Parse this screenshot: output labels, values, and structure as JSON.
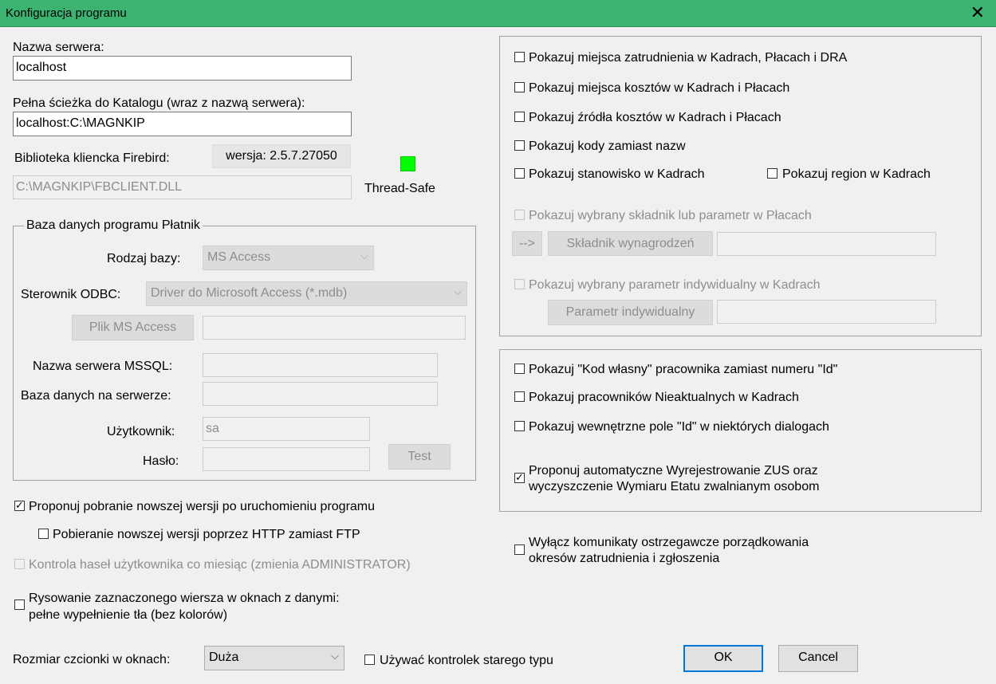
{
  "window": {
    "title": "Konfiguracja programu",
    "close_glyph": "✕"
  },
  "server": {
    "name_label": "Nazwa serwera:",
    "name_value": "localhost",
    "path_label": "Pełna ścieżka do Katalogu (wraz z nazwą serwera):",
    "path_value": "localhost:C:\\MAGNKIP",
    "client_label": "Biblioteka kliencka Firebird:",
    "client_version": "wersja: 2.5.7.27050",
    "client_path": "C:\\MAGNKIP\\FBCLIENT.DLL",
    "thread_safe_label": "Thread-Safe",
    "thread_safe_color": "#00ff00"
  },
  "db_group": {
    "legend": "Baza danych programu Płatnik",
    "type_label": "Rodzaj bazy:",
    "type_value": "MS Access",
    "odbc_label": "Sterownik ODBC:",
    "odbc_value": "Driver do Microsoft Access (*.mdb)",
    "ms_access_button": "Plik MS Access",
    "ms_access_value": "",
    "mssql_label": "Nazwa serwera MSSQL:",
    "mssql_value": "",
    "dbname_label": "Baza danych na serwerze:",
    "dbname_value": "",
    "user_label": "Użytkownik:",
    "user_value": "sa",
    "pass_label": "Hasło:",
    "pass_value": "",
    "test_button": "Test"
  },
  "left_options": [
    {
      "label": "Proponuj pobranie nowszej wersji po uruchomieniu programu",
      "checked": true,
      "enabled": true
    },
    {
      "label": "Pobieranie nowszej wersji poprzez HTTP zamiast FTP",
      "checked": false,
      "enabled": true
    },
    {
      "label": "Kontrola haseł użytkownika co miesiąc (zmienia ADMINISTRATOR)",
      "checked": false,
      "enabled": false
    },
    {
      "label_line1": "Rysowanie zaznaczonego wiersza w oknach z danymi:",
      "label_line2": "pełne wypełnienie tła (bez kolorów)",
      "checked": false,
      "enabled": true
    }
  ],
  "font_size": {
    "label": "Rozmiar czcionki w oknach:",
    "value": "Duża"
  },
  "old_controls": {
    "label": "Używać kontrolek starego typu",
    "checked": false
  },
  "right_group1": {
    "options": [
      {
        "label": "Pokazuj miejsca zatrudnienia w Kadrach, Płacach i DRA",
        "checked": false
      },
      {
        "label": "Pokazuj miejsca kosztów w Kadrach i Płacach",
        "checked": false
      },
      {
        "label": "Pokazuj źródła kosztów w Kadrach i Płacach",
        "checked": false
      },
      {
        "label": "Pokazuj kody zamiast nazw",
        "checked": false
      },
      {
        "label": "Pokazuj stanowisko w Kadrach",
        "checked": false
      },
      {
        "label": "Pokazuj region w Kadrach",
        "checked": false
      }
    ],
    "component_option": {
      "label": "Pokazuj wybrany składnik lub parametr w Płacach",
      "checked": false,
      "enabled": false
    },
    "arrow_button": "-->",
    "component_button": "Składnik wynagrodzeń",
    "component_value": "",
    "param_option": {
      "label": "Pokazuj wybrany parametr indywidualny w Kadrach",
      "checked": false,
      "enabled": false
    },
    "param_button": "Parametr indywidualny",
    "param_value": ""
  },
  "right_group2": {
    "options": [
      {
        "label": "Pokazuj \"Kod własny\" pracownika zamiast numeru \"Id\"",
        "checked": false
      },
      {
        "label": "Pokazuj pracowników Nieaktualnych w Kadrach",
        "checked": false
      },
      {
        "label": "Pokazuj wewnętrzne pole \"Id\" w niektórych dialogach",
        "checked": false
      }
    ],
    "zus_option": {
      "label_line1": "Proponuj automatyczne Wyrejestrowanie ZUS oraz",
      "label_line2": "wyczyszczenie Wymiaru Etatu zwalnianym osobom",
      "checked": true
    }
  },
  "warnings_option": {
    "label_line1": "Wyłącz komunikaty ostrzegawcze porządkowania",
    "label_line2": "okresów zatrudnienia i zgłoszenia",
    "checked": false
  },
  "buttons": {
    "ok": "OK",
    "cancel": "Cancel"
  },
  "icons": {
    "check_glyph": "✓",
    "chevron_glyph": "⌵"
  }
}
